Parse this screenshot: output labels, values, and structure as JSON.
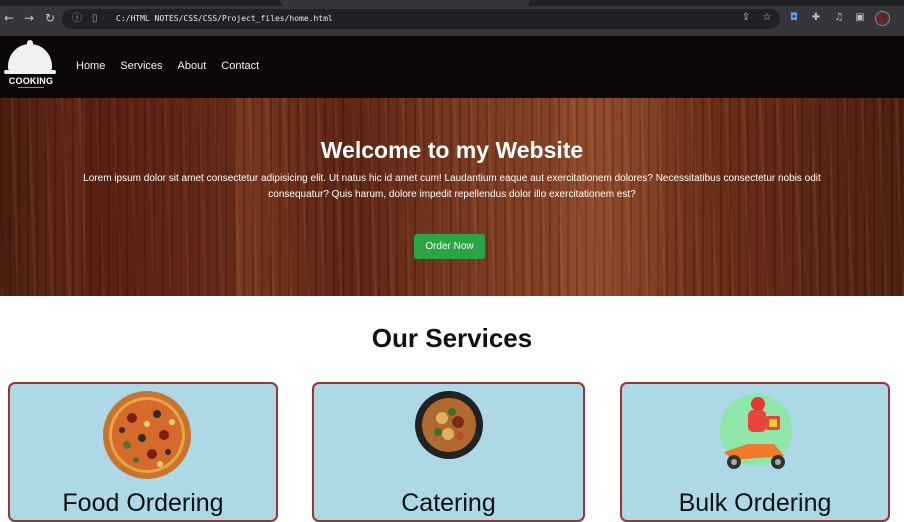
{
  "browser": {
    "url": "C:/HTML NOTES/CSS/CSS/Project_files/home.html",
    "icons": [
      "back-icon",
      "forward-icon",
      "reload-icon",
      "site-info-icon",
      "file-icon",
      "share-icon",
      "bookmark-star-icon",
      "extension-icon",
      "puzzle-icon",
      "media-icon",
      "sidebar-icon",
      "profile-icon"
    ]
  },
  "header": {
    "logo_text": "COOKING",
    "nav": [
      "Home",
      "Services",
      "About",
      "Contact"
    ]
  },
  "hero": {
    "title": "Welcome to my Website",
    "text": "Lorem ipsum dolor sit amet consectetur adipisicing elit. Ut natus hic id amet cum! Laudantium eaque aut exercitationem dolores? Necessitatibus consectetur nobis odit consequatur? Quis harum, dolore impedit repellendus dolor illo exercitationem est?",
    "button": "Order Now"
  },
  "services": {
    "title": "Our Services",
    "cards": [
      {
        "title": "Food Ordering",
        "image": "pizza-image"
      },
      {
        "title": "Catering",
        "image": "noodle-bowl-image"
      },
      {
        "title": "Bulk Ordering",
        "image": "delivery-scooter-image"
      }
    ]
  },
  "colors": {
    "hero_wood": "#6b2c17",
    "button_green": "#2aa544",
    "card_bg": "#add8e6",
    "card_border": "#9b3434"
  }
}
